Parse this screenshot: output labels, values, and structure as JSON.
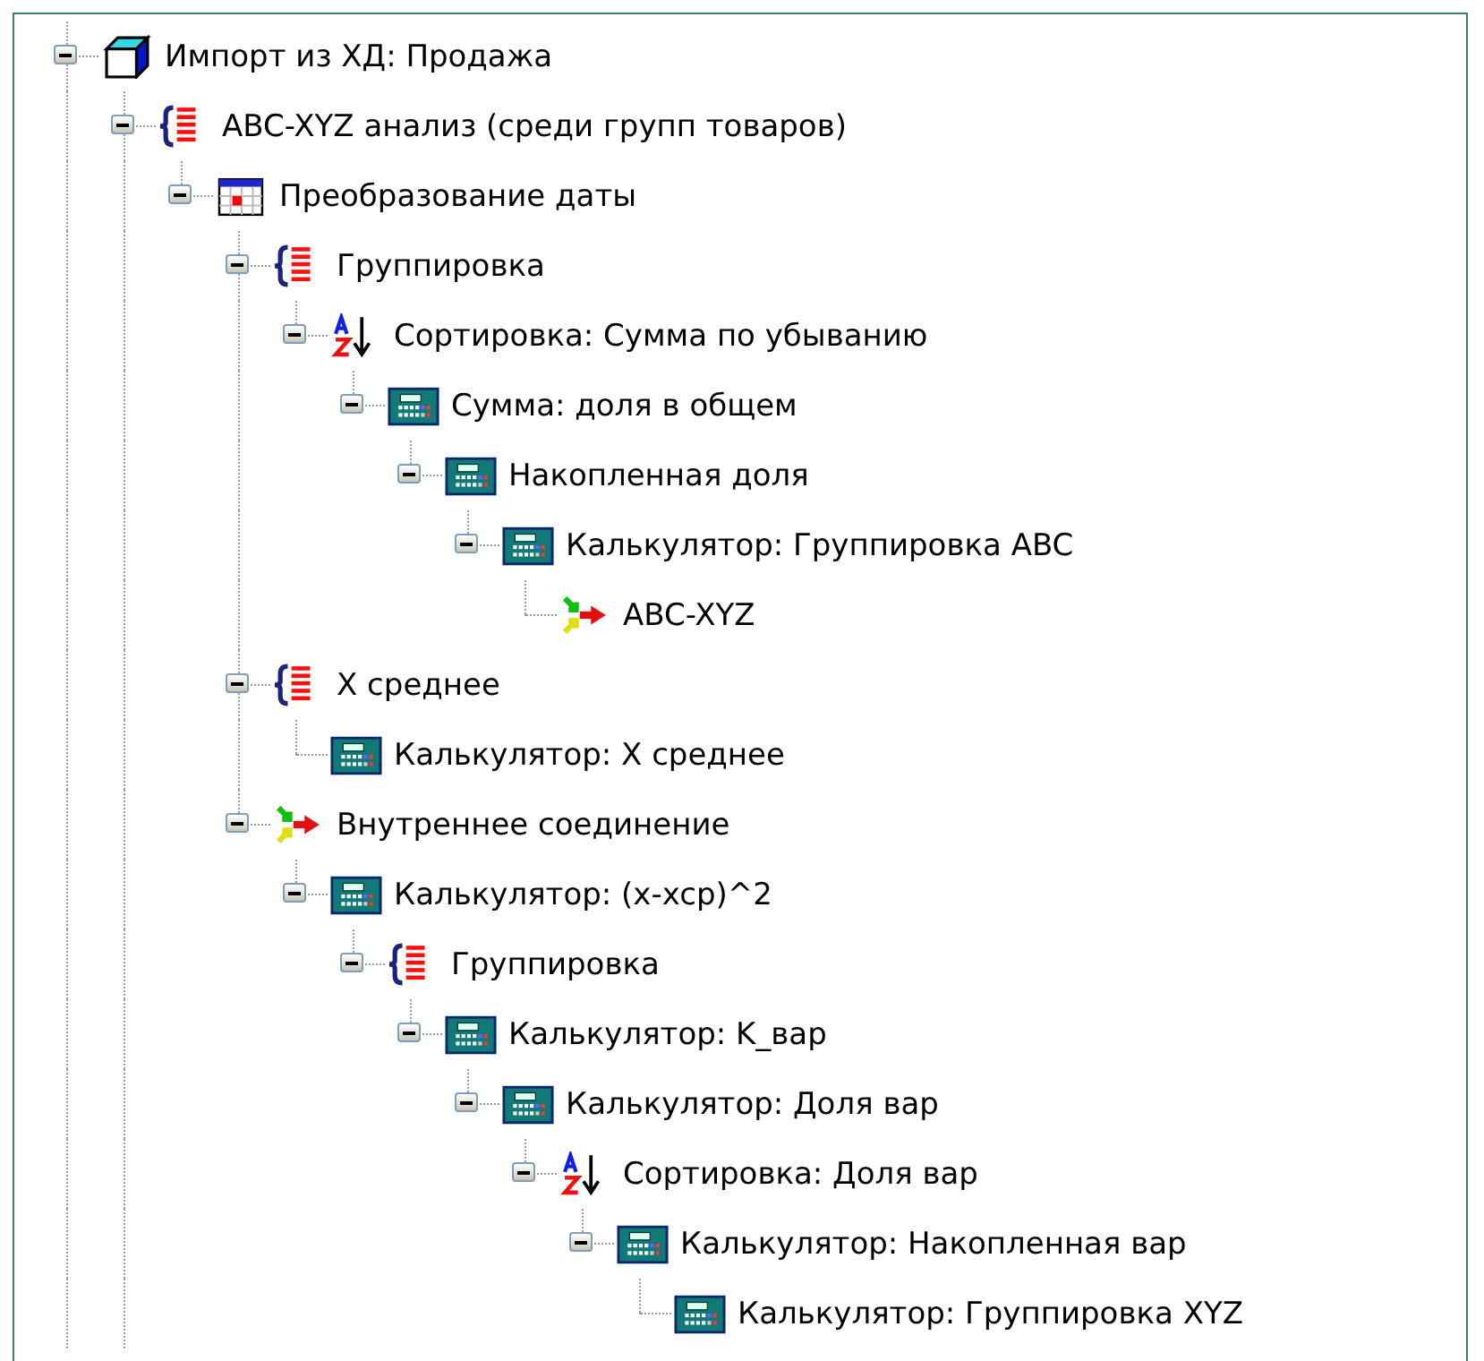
{
  "tree": [
    {
      "label": "Импорт из ХД: Продажа",
      "kind": "cube",
      "expanded": true,
      "children": [
        {
          "label": "ABC-XYZ анализ (среди групп товаров)",
          "kind": "group",
          "expanded": true,
          "children": [
            {
              "label": "Преобразование даты",
              "kind": "table",
              "expanded": true,
              "children": [
                {
                  "label": "Группировка",
                  "kind": "group",
                  "expanded": true,
                  "children": [
                    {
                      "label": "Сортировка: Сумма по убыванию",
                      "kind": "sort",
                      "expanded": true,
                      "children": [
                        {
                          "label": "Сумма: доля в общем",
                          "kind": "calc",
                          "expanded": true,
                          "children": [
                            {
                              "label": "Накопленная доля",
                              "kind": "calc",
                              "expanded": true,
                              "children": [
                                {
                                  "label": "Калькулятор: Группировка ABC",
                                  "kind": "calc",
                                  "expanded": true,
                                  "children": [
                                    {
                                      "label": "ABC-XYZ",
                                      "kind": "join"
                                    }
                                  ]
                                }
                              ]
                            }
                          ]
                        }
                      ]
                    }
                  ]
                },
                {
                  "label": "X среднее",
                  "kind": "group",
                  "expanded": true,
                  "children": [
                    {
                      "label": "Калькулятор: X среднее",
                      "kind": "calc"
                    }
                  ]
                },
                {
                  "label": "Внутреннее соединение",
                  "kind": "join",
                  "expanded": true,
                  "children": [
                    {
                      "label": "Калькулятор: (x-xcp)^2",
                      "kind": "calc",
                      "expanded": true,
                      "children": [
                        {
                          "label": "Группировка",
                          "kind": "group",
                          "expanded": true,
                          "children": [
                            {
                              "label": "Калькулятор: K_вар",
                              "kind": "calc",
                              "expanded": true,
                              "children": [
                                {
                                  "label": "Калькулятор: Доля вар",
                                  "kind": "calc",
                                  "expanded": true,
                                  "children": [
                                    {
                                      "label": "Сортировка: Доля вар",
                                      "kind": "sort",
                                      "expanded": true,
                                      "children": [
                                        {
                                          "label": "Калькулятор: Накопленная вар",
                                          "kind": "calc",
                                          "expanded": true,
                                          "children": [
                                            {
                                              "label": "Калькулятор: Группировка XYZ",
                                              "kind": "calc"
                                            }
                                          ]
                                        }
                                      ]
                                    }
                                  ]
                                }
                              ]
                            }
                          ]
                        }
                      ]
                    }
                  ]
                }
              ]
            }
          ]
        }
      ]
    }
  ]
}
